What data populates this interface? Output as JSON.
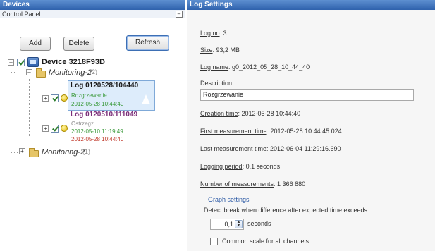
{
  "devices_panel": {
    "title": "Devices",
    "subtitle": "Control Panel",
    "collapse_glyph": "–",
    "buttons": {
      "add": "Add",
      "delete": "Delete",
      "refresh": "Refresh"
    },
    "tree": {
      "device": {
        "expander": "–",
        "label": "Device 3218F93D",
        "icon": "device-icon"
      },
      "monitoring_1": {
        "expander": "–",
        "label": "Monitoring-2",
        "badge": "(2)",
        "logs": [
          {
            "expander": "+",
            "name": "Log 0120528/104440",
            "sub": "Rozgrzewanie",
            "time": "2012-05-28 10:44:40"
          },
          {
            "expander": "+",
            "name": "Log 0120510/111049",
            "sub": "Ostrzegz",
            "time_start": "2012-05-10 11:19:49",
            "time_end": "2012-05-28 10:44:40"
          }
        ]
      },
      "monitoring_2": {
        "expander": "+",
        "label": "Monitoring-2",
        "badge": "(1)"
      }
    }
  },
  "log_settings": {
    "title": "Log Settings",
    "log_no_label": "Log no",
    "log_no_value": ": 3",
    "size_label": "Size",
    "size_value": ": 93,2 MB",
    "log_name_label": "Log name",
    "log_name_value": ": g0_2012_05_28_10_44_40",
    "description_label": "Description",
    "description_value": "Rozgrzewanie",
    "creation_time_label": "Creation time",
    "creation_time_value": ": 2012-05-28 10:44:40",
    "first_meas_label": "First measurement time",
    "first_meas_value": ": 2012-05-28 10:44:45.024",
    "last_meas_label": "Last measurement time",
    "last_meas_value": ": 2012-06-04 11:29:16.690",
    "logging_period_label": "Logging period",
    "logging_period_value": ": 0,1 seconds",
    "num_meas_label": "Number of measurements",
    "num_meas_value": ": 1 366 880",
    "graph_settings_title": "Graph settings",
    "detect_break_text": "Detect break when difference after expected time exceeds",
    "break_value": "0,1",
    "break_unit": "seconds",
    "common_scale_label": "Common scale for all channels"
  },
  "colors": {
    "title_bar": "#2f62ad",
    "link_blue": "#2a58a4",
    "green": "#3c9a3c",
    "red": "#c0392b"
  }
}
